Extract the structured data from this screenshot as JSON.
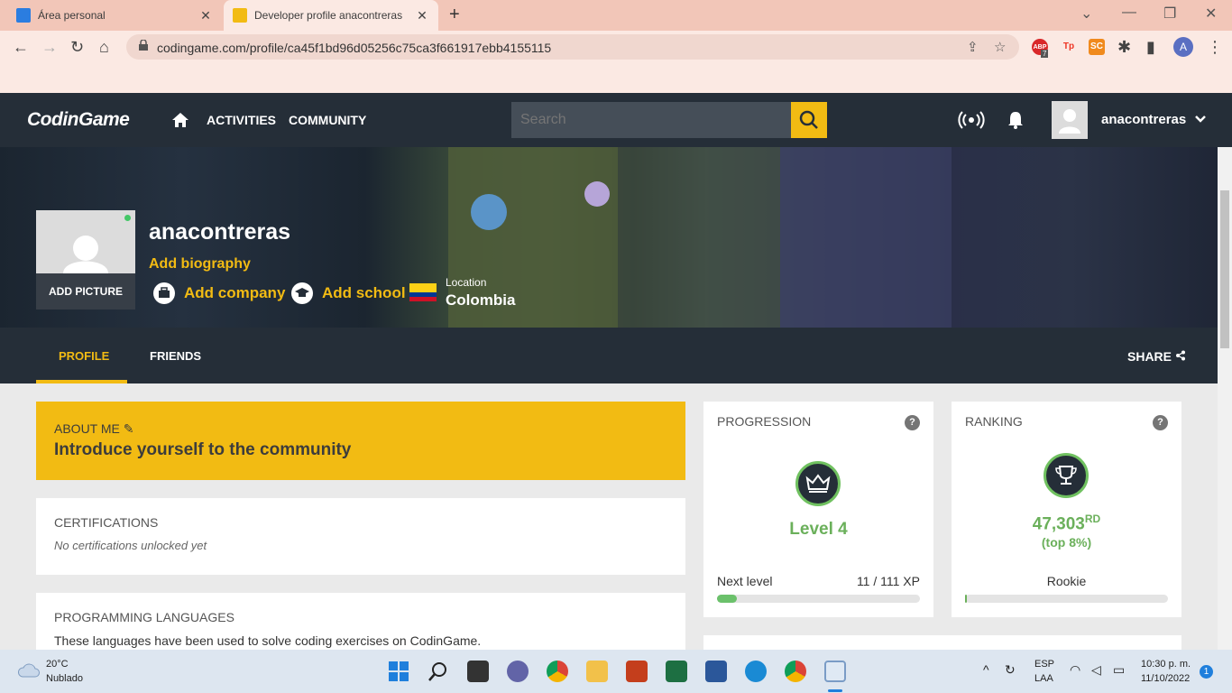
{
  "browser": {
    "tabs": [
      {
        "title": "Área personal",
        "active": false
      },
      {
        "title": "Developer profile anacontreras",
        "active": true
      }
    ],
    "url": "codingame.com/profile/ca45f1bd96d05256c75ca3f661917ebb4155115",
    "profile_initial": "A",
    "abp_count": "7",
    "ext_labels": [
      "ABP",
      "Tp",
      "SC"
    ]
  },
  "header": {
    "logo_codin": "CodinGame",
    "nav": [
      "ACTIVITIES",
      "COMMUNITY"
    ],
    "search_placeholder": "Search",
    "username": "anacontreras"
  },
  "profile": {
    "name": "anacontreras",
    "add_picture": "ADD PICTURE",
    "add_biography": "Add biography",
    "add_company": "Add company",
    "add_school": "Add school",
    "location_label": "Location",
    "location": "Colombia"
  },
  "tabs": {
    "profile": "PROFILE",
    "friends": "FRIENDS",
    "share": "SHARE"
  },
  "about": {
    "label": "ABOUT ME",
    "text": "Introduce yourself to the community"
  },
  "certifications": {
    "title": "CERTIFICATIONS",
    "text": "No certifications unlocked yet"
  },
  "languages": {
    "title": "PROGRAMMING LANGUAGES",
    "text": "These languages have been used to solve coding exercises on CodinGame."
  },
  "progression": {
    "title": "PROGRESSION",
    "level": "Level 4",
    "next_level_label": "Next level",
    "xp": "11 / 111 XP",
    "xp_fraction": 0.099
  },
  "ranking": {
    "title": "RANKING",
    "rank": "47,303",
    "suffix": "RD",
    "top": "(top 8%)",
    "tier": "Rookie",
    "bar_fraction": 0.005
  },
  "taskbar": {
    "temp": "20°C",
    "weather": "Nublado",
    "lang1": "ESP",
    "lang2": "LAA",
    "time": "10:30 p. m.",
    "date": "11/10/2022",
    "notif": "1"
  },
  "colors": {
    "accent": "#f2bb13",
    "nav_bg": "#252e38",
    "success": "#6bb05b"
  }
}
